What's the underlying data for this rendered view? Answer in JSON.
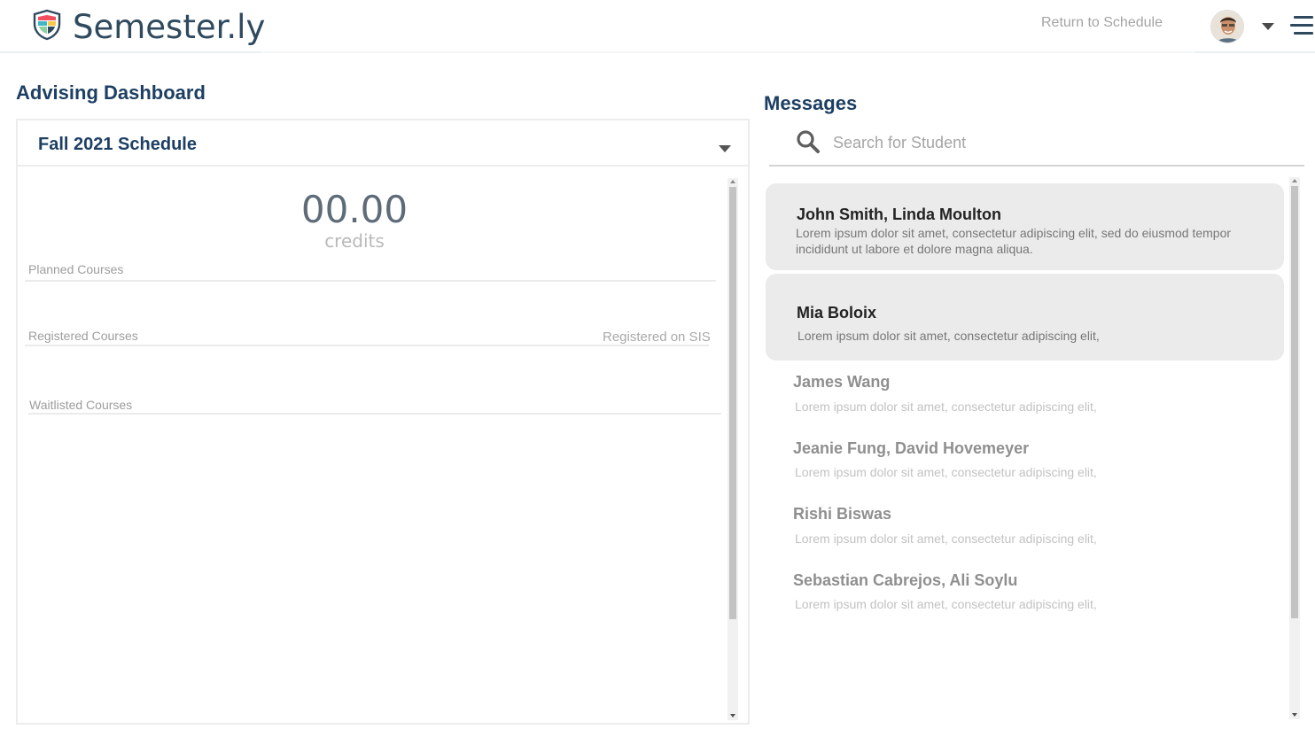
{
  "header": {
    "brand": "Semester.ly",
    "return_link": "Return to Schedule",
    "colors": {
      "brand_text": "#2f4a5e",
      "nav_text": "#a4a4a4"
    },
    "icons": [
      "semesterly-shield-logo-icon",
      "user-avatar",
      "chevron-down-icon",
      "hamburger-menu-icon"
    ]
  },
  "advising": {
    "title": "Advising Dashboard",
    "schedule": {
      "selected": "Fall 2021 Schedule",
      "credits_value": "00.00",
      "credits_label": "credits",
      "sections": {
        "planned": "Planned Courses",
        "registered": "Registered Courses",
        "registered_status": "Registered on SIS",
        "waitlisted": "Waitlisted Courses"
      }
    }
  },
  "messages": {
    "title": "Messages",
    "search": {
      "placeholder": "Search for Student",
      "value": ""
    },
    "threads": [
      {
        "name": "John Smith, Linda Moulton",
        "preview": "Lorem ipsum dolor sit amet, consectetur adipiscing elit, sed do eiusmod tempor incididunt ut labore et dolore magna aliqua.",
        "highlighted": true
      },
      {
        "name": "Mia Boloix",
        "preview": "Lorem ipsum dolor sit amet, consectetur adipiscing elit,",
        "highlighted": true
      },
      {
        "name": "James Wang",
        "preview": "Lorem ipsum dolor sit amet, consectetur adipiscing elit,",
        "highlighted": false
      },
      {
        "name": "Jeanie Fung, David Hovemeyer",
        "preview": "Lorem ipsum dolor sit amet, consectetur adipiscing elit,",
        "highlighted": false
      },
      {
        "name": "Rishi Biswas",
        "preview": "Lorem ipsum dolor sit amet, consectetur adipiscing elit,",
        "highlighted": false
      },
      {
        "name": "Sebastian Cabrejos, Ali Soylu",
        "preview": "Lorem ipsum dolor sit amet, consectetur adipiscing elit,",
        "highlighted": false
      }
    ]
  },
  "colors": {
    "heading": "#1d3f63",
    "card_border": "#ececec",
    "thread_highlight": "#ebebeb"
  }
}
